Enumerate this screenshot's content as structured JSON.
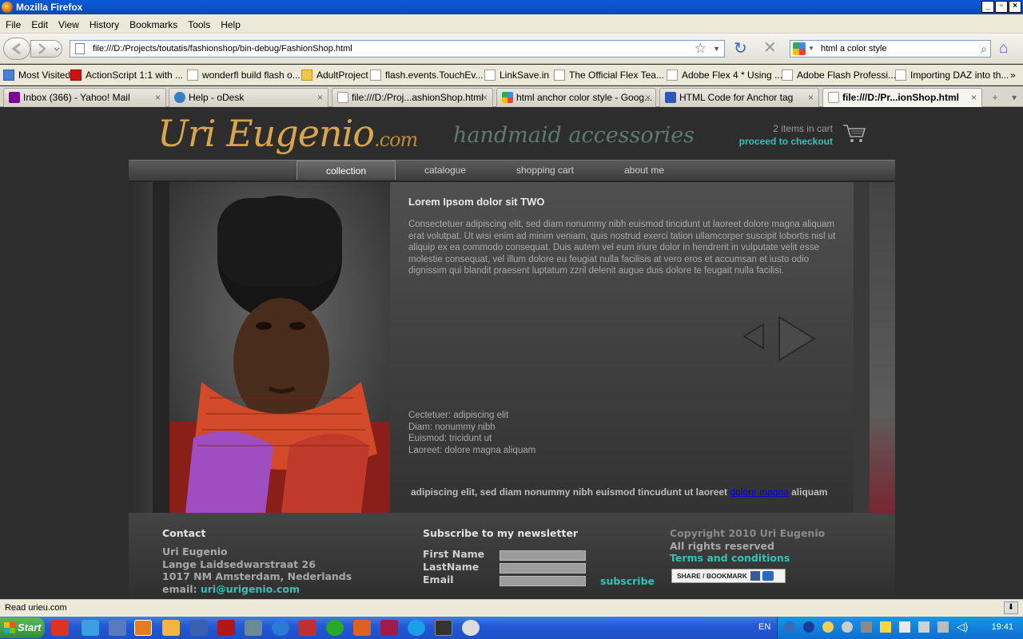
{
  "window": {
    "title": "Mozilla Firefox"
  },
  "menu": [
    "File",
    "Edit",
    "View",
    "History",
    "Bookmarks",
    "Tools",
    "Help"
  ],
  "navbar": {
    "url": "file:///D:/Projects/toutatis/fashionshop/bin-debug/FashionShop.html",
    "search": "html a color style"
  },
  "bookmarks": [
    "Most Visited",
    "ActionScript 1:1 with ...",
    "wonderfl build flash o...",
    "AdultProject",
    "flash.events.TouchEv...",
    "LinkSave.in",
    "The Official Flex Tea...",
    "Adobe Flex 4 * Using ...",
    "Adobe Flash Professi...",
    "Importing DAZ into th..."
  ],
  "tabs": [
    {
      "label": "Inbox (366) - Yahoo! Mail",
      "icon_color": "#7b0099"
    },
    {
      "label": "Help - oDesk",
      "icon_color": "#3a7fc4"
    },
    {
      "label": "file:///D:/Proj...ashionShop.html",
      "icon_color": "#ffffff"
    },
    {
      "label": "html anchor color style - Goog...",
      "icon_color": "#4285f4"
    },
    {
      "label": "HTML Code for Anchor tag",
      "icon_color": "#2a59b8"
    },
    {
      "label": "file:///D:/Pr...ionShop.html",
      "icon_color": "#ffffff"
    }
  ],
  "site": {
    "logo_main": "Uri Eugenio",
    "logo_suffix": ".com",
    "tagline": "handmaid accessories",
    "cart_count": "2 items in cart",
    "checkout": "proceed to checkout",
    "nav": [
      "collection",
      "catalogue",
      "shopping cart",
      "about me"
    ],
    "nav_active": "collection",
    "article": {
      "title": "Lorem Ipsom dolor sit TWO",
      "body": "Consectetuer adipiscing elit, sed diam nonummy nibh euismod tincidunt ut laoreet dolore magna aliquam erat volutpat. Ut wisi enim ad minim veniam, quis nostrud exerci tation ullamcorper suscipit lobortis nisl ut aliquip ex ea commodo consequat. Duis autem vel eum iriure dolor in hendrerit in vulputate velit esse molestie consequat, vel illum dolore eu feugiat nulla facilisis at vero eros et accumsan et iusto odio dignissim qui blandit praesent luptatum zzril delenit augue duis dolore te feugait nulla facilisi.",
      "details": [
        "Cectetuer: adipiscing elit",
        "Diam: nonummy nibh",
        "Euismod: tricidunt ut",
        "Laoreet: dolore magna aliquam"
      ],
      "footer_before": "adipiscing elit, sed diam nonummy nibh euismod tincudunt ut laoreet ",
      "footer_link": "dolore magna",
      "footer_after": " aliquam"
    },
    "footer": {
      "contact_title": "Contact",
      "contact_lines": [
        "Uri Eugenio",
        "Lange Laidsedwarstraat 26",
        "1017 NM Amsterdam, Nederlands"
      ],
      "email_label": "email: ",
      "email": "uri@urigenio.com",
      "newsletter_title": "Subscribe to my newsletter",
      "fields": [
        "First Name",
        "LastName",
        "Email"
      ],
      "subscribe": "subscribe",
      "copyright": "Copyright 2010 Uri Eugenio",
      "rights": "All rights reserved",
      "terms": "Terms and conditions",
      "share": "SHARE / BOOKMARK"
    }
  },
  "status": "Read urieu.com",
  "taskbar": {
    "start": "Start",
    "lang": "EN",
    "time": "19:41"
  },
  "colors": {
    "accent_teal": "#33c3b6",
    "logo_gold": "#d9a54b",
    "page_bg": "#2d2d2d"
  }
}
